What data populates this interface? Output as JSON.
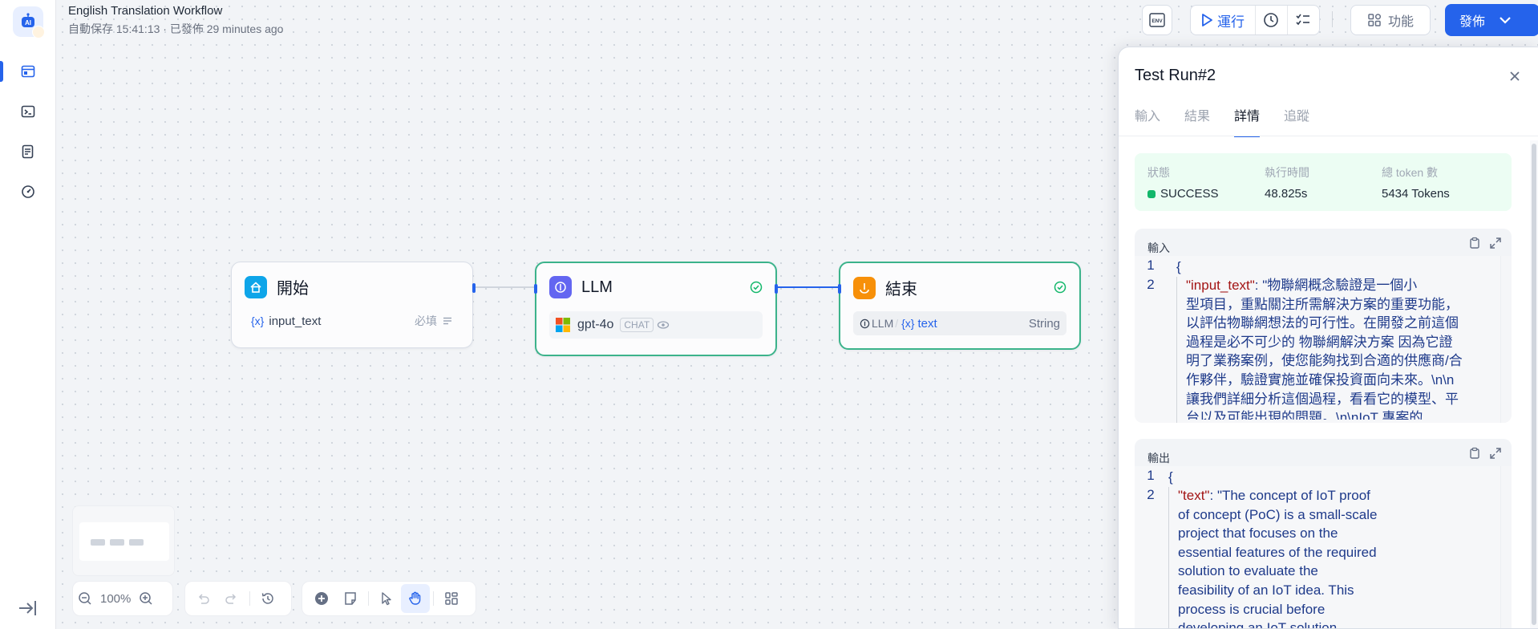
{
  "app": {
    "title": "English Translation Workflow",
    "subtitle": "自動保存 15:41:13 · 已發佈 29 minutes ago"
  },
  "toolbar": {
    "env_label": "ENV",
    "run_label": "運行",
    "features_label": "功能",
    "publish_label": "發佈"
  },
  "nodes": {
    "start": {
      "title": "開始",
      "var_prefix": "{x}",
      "var_name": "input_text",
      "required": "必填"
    },
    "llm": {
      "title": "LLM",
      "model": "gpt-4o",
      "mode": "CHAT"
    },
    "end": {
      "title": "結束",
      "source": "LLM",
      "slash": "/",
      "var_prefix": "{x}",
      "var_name": "text",
      "type": "String"
    }
  },
  "zoom": {
    "level": "100%"
  },
  "panel": {
    "title": "Test Run#2",
    "tabs": [
      "輸入",
      "結果",
      "詳情",
      "追蹤"
    ],
    "active_tab": "詳情",
    "status": {
      "status_label": "狀態",
      "status_value": "SUCCESS",
      "time_label": "執行時間",
      "time_value": "48.825s",
      "tokens_label": "總 token 數",
      "tokens_value": "5434 Tokens"
    },
    "input": {
      "label": "輸入",
      "line1": "1",
      "line2": "2",
      "open_brace": "{",
      "key": "\"input_text\"",
      "colon": ": ",
      "value_lines": [
        "\"物聯網概念驗證是一個小",
        "型項目，重點關注所需解決方案的重要功能，",
        "以評估物聯網想法的可行性。在開發之前這個",
        "過程是必不可少的 物聯網解決方案 因為它證",
        "明了業務案例，使您能夠找到合適的供應商/合",
        "作夥伴，驗證實施並確保投資面向未來。\\n\\n",
        "讓我們詳細分析這個過程，看看它的模型、平",
        "台以及可能出現的問題。\\n\\nIoT 專案的"
      ]
    },
    "output": {
      "label": "輸出",
      "line1": "1",
      "line2": "2",
      "open_brace": "{",
      "key": "\"text\"",
      "colon": ": ",
      "value_lines": [
        "\"The concept of IoT proof",
        "of concept (PoC) is a small-scale",
        "project that focuses on the",
        "essential features of the required",
        "solution to evaluate the",
        "feasibility of an IoT idea. This",
        "process is crucial before",
        "developing an IoT solution"
      ]
    }
  },
  "colors": {
    "accent": "#2563eb",
    "success": "#12b76a",
    "node_ok_border": "#3cb38b",
    "start_icon": "#0ea5e9",
    "llm_icon": "#6366f1",
    "end_icon": "#f79009"
  }
}
